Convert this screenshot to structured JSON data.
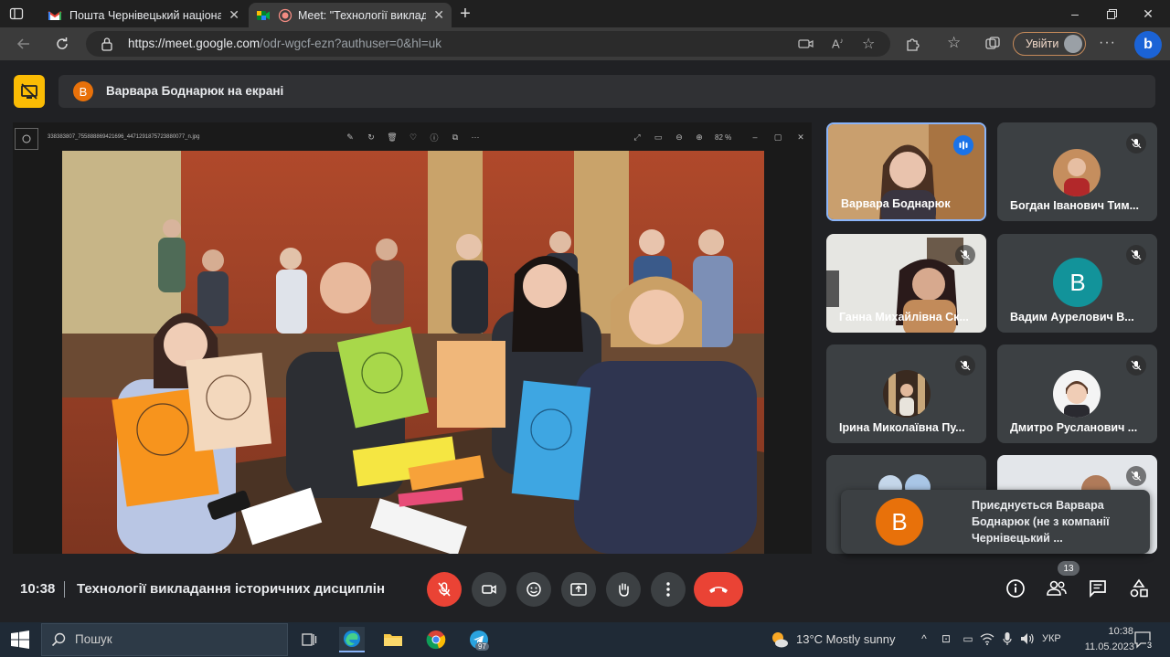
{
  "browser": {
    "tabs": [
      {
        "title": "Пошта Чернівецький національ",
        "active": false
      },
      {
        "title": "Meet: \"Технології викладан",
        "active": true
      }
    ],
    "url_host": "https://meet.google.com",
    "url_path": "/odr-wgcf-ezn?authuser=0&hl=uk",
    "signin_label": "Увійти"
  },
  "meet": {
    "presenter_initial": "В",
    "presenter_text": "Варвара Боднарюк на екрані",
    "viewer": {
      "filename": "338383807_755888869421696_4471291875723880077_n.jpg",
      "zoom": "82 %"
    },
    "participants": [
      {
        "name": "Варвара Боднарюк",
        "speaking": true,
        "muted": false
      },
      {
        "name": "Богдан Іванович Тим...",
        "muted": true
      },
      {
        "name": "Ганна Михайлівна Ск...",
        "muted": true
      },
      {
        "name": "Вадим Аурелович В...",
        "muted": true,
        "initial": "В"
      },
      {
        "name": "Ірина Миколаївна Пу...",
        "muted": true
      },
      {
        "name": "Дмитро Русланович ...",
        "muted": true
      },
      {
        "name": "",
        "muted": false
      },
      {
        "name": "",
        "muted": true
      }
    ],
    "toast": {
      "initial": "В",
      "text": "Приєднується Варвара Боднарюк (не з компанії Чернівецький ..."
    },
    "time": "10:38",
    "meeting_title": "Технології викладання історичних дисциплін",
    "people_count": "13"
  },
  "taskbar": {
    "search_placeholder": "Пошук",
    "telegram_badge": "97",
    "weather": "13°C  Mostly sunny",
    "language": "УКР",
    "time": "10:38",
    "date": "11.05.2023",
    "notification_count": "3"
  },
  "colors": {
    "accent_yellow": "#fbbc04",
    "danger_red": "#ea4335",
    "avatar_orange": "#e8710a",
    "avatar_teal": "#12939a",
    "speaking_blue": "#8ab4f8"
  }
}
